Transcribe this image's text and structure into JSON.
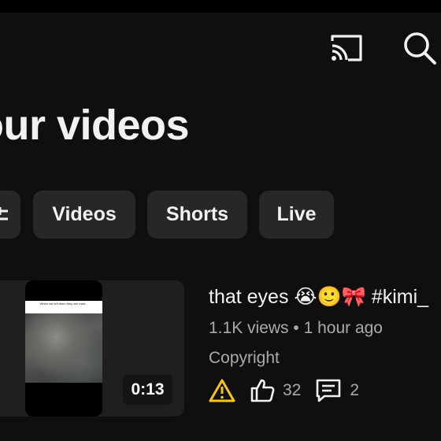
{
  "header": {
    "cast_icon": "cast-icon",
    "search_icon": "search-icon"
  },
  "page": {
    "title": "our videos"
  },
  "filters": {
    "sort_icon": "sort-icon",
    "chips": [
      "Videos",
      "Shorts",
      "Live"
    ]
  },
  "video": {
    "thumbnail_caption": "When we tell them they are mad...",
    "duration": "0:13",
    "title": "that eyes 😭🙂🎀 #kimi_",
    "meta": "1.1K views • 1 hour ago",
    "license": "Copyright",
    "warning_icon": "warning-icon",
    "likes": "32",
    "comments": "2"
  },
  "colors": {
    "background": "#0f0f0f",
    "chip": "#272727",
    "secondary_text": "#aaaaaa",
    "warning": "#f5c518"
  }
}
